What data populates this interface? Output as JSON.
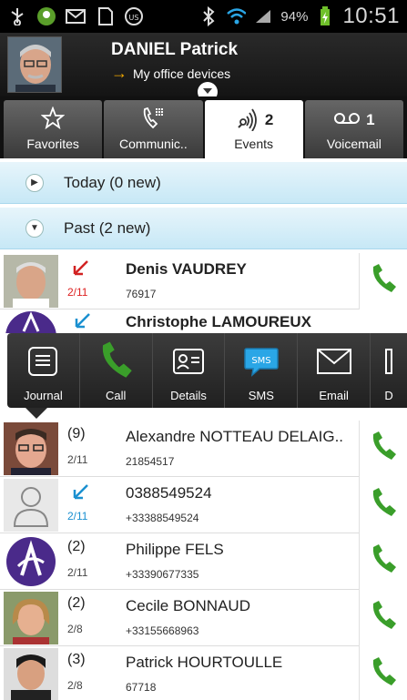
{
  "status_bar": {
    "battery": "94%",
    "time": "10:51"
  },
  "profile": {
    "name": "DANIEL Patrick",
    "subtitle": "My office devices"
  },
  "tabs": [
    {
      "label": "Favorites",
      "badge": "",
      "active": false
    },
    {
      "label": "Communic..",
      "badge": "",
      "active": false
    },
    {
      "label": "Events",
      "badge": "2",
      "active": true
    },
    {
      "label": "Voicemail",
      "badge": "1",
      "active": false
    }
  ],
  "sections": {
    "today": "Today (0 new)",
    "past": "Past (2 new)"
  },
  "rows": [
    {
      "name": "Denis VAUDREY",
      "number": "76917",
      "date": "2/11",
      "count": "",
      "direction": "missed"
    },
    {
      "name": "Christophe LAMOUREUX",
      "number": "",
      "date": "",
      "count": "",
      "direction": "incoming"
    },
    {
      "name": "Alexandre NOTTEAU DELAIG..",
      "number": "21854517",
      "date": "2/11",
      "count": "(9)",
      "direction": ""
    },
    {
      "name": "0388549524",
      "number": "+33388549524",
      "date": "2/11",
      "count": "",
      "direction": "incoming"
    },
    {
      "name": "Philippe FELS",
      "number": "+33390677335",
      "date": "2/11",
      "count": "(2)",
      "direction": ""
    },
    {
      "name": "Cecile BONNAUD",
      "number": "+33155668963",
      "date": "2/8",
      "count": "(2)",
      "direction": ""
    },
    {
      "name": "Patrick HOURTOULLE",
      "number": "67718",
      "date": "2/8",
      "count": "(3)",
      "direction": ""
    }
  ],
  "popup_actions": [
    {
      "label": "Journal",
      "icon": "journal-icon"
    },
    {
      "label": "Call",
      "icon": "phone-icon"
    },
    {
      "label": "Details",
      "icon": "contact-card-icon"
    },
    {
      "label": "SMS",
      "icon": "sms-icon"
    },
    {
      "label": "Email",
      "icon": "envelope-icon"
    },
    {
      "label": "D",
      "icon": "more-icon"
    }
  ],
  "colors": {
    "call_green": "#3a9e2a",
    "missed_red": "#d22222",
    "incoming_blue": "#1a90d0",
    "section_blue": "#c7e8f6",
    "sms_blue": "#2aa6e6"
  }
}
